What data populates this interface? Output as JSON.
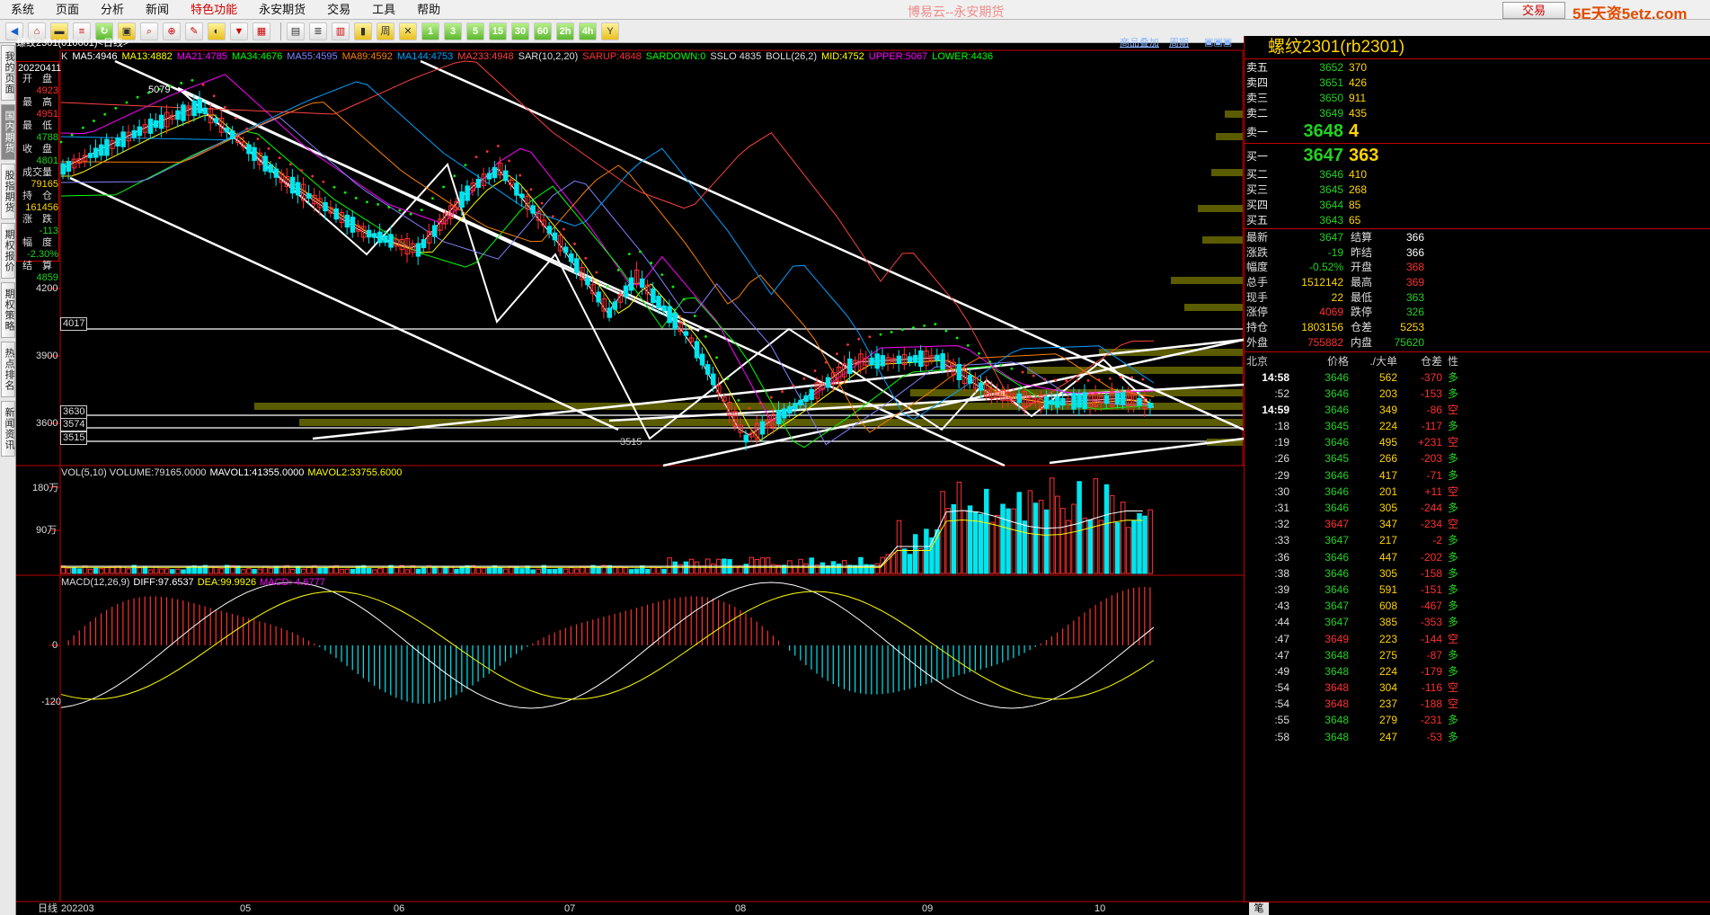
{
  "menu": [
    "系统",
    "页面",
    "分析",
    "新闻",
    "特色功能",
    "永安期货",
    "交易",
    "工具",
    "帮助"
  ],
  "app_title": "博易云--永安期货",
  "trade_button": "交易",
  "brand": "5E天资5etz.com",
  "toolbar_labels": [
    "周",
    "1",
    "3",
    "5",
    "15",
    "30",
    "60",
    "2h",
    "4h",
    "Y"
  ],
  "left_tabs": [
    "我的页面",
    "国内期货",
    "股指期货",
    "期权报价",
    "期权策略",
    "热点排名",
    "新闻资讯"
  ],
  "chart_header": {
    "symbol_line": "螺纹2301(010601)<日线>",
    "add_button": "商品叠加",
    "period_button": "周期"
  },
  "ma_line": [
    {
      "text": "K",
      "color": "#dddddd"
    },
    {
      "text": "MA5:4946",
      "color": "#ffffff"
    },
    {
      "text": "MA13:4882",
      "color": "#ffff00"
    },
    {
      "text": "MA21:4785",
      "color": "#ff00ff"
    },
    {
      "text": "MA34:4676",
      "color": "#00ff00"
    },
    {
      "text": "MA55:4595",
      "color": "#8080ff"
    },
    {
      "text": "MA89:4592",
      "color": "#ff8000"
    },
    {
      "text": "MA144:4753",
      "color": "#00a0ff"
    },
    {
      "text": "MA233:4948",
      "color": "#ff4040"
    },
    {
      "text": "SAR(10,2,20)",
      "color": "#dddddd"
    },
    {
      "text": "SARUP:4848",
      "color": "#ff3030"
    },
    {
      "text": "SARDOWN:0",
      "color": "#00ff00"
    },
    {
      "text": "SSLO 4835",
      "color": "#dddddd"
    },
    {
      "text": "BOLL(26,2)",
      "color": "#dddddd"
    },
    {
      "text": "MID:4752",
      "color": "#ffff00"
    },
    {
      "text": "UPPER:5067",
      "color": "#ff00ff"
    },
    {
      "text": "LOWER:4436",
      "color": "#00ff00"
    }
  ],
  "info_box": {
    "date": "20220411",
    "fields": [
      {
        "label": "开　盘",
        "value": "4923",
        "color": "#ff3030"
      },
      {
        "label": "最　高",
        "value": "4951",
        "color": "#ff3030"
      },
      {
        "label": "最　低",
        "value": "4788",
        "color": "#23d123"
      },
      {
        "label": "收　盘",
        "value": "4801",
        "color": "#23d123"
      },
      {
        "label": "成交量",
        "value": "79165",
        "color": "#ffd400"
      },
      {
        "label": "持　仓",
        "value": "161456",
        "color": "#ffd400"
      },
      {
        "label": "涨　跌",
        "value": "-113",
        "color": "#23d123"
      },
      {
        "label": "幅　度",
        "value": "-2.30%",
        "color": "#23d123"
      },
      {
        "label": "结　算",
        "value": "4859",
        "color": "#23d123"
      }
    ]
  },
  "price_axis": [
    "4200",
    "3900",
    "3600"
  ],
  "price_markers": [
    "4017",
    "3630",
    "3574",
    "3515"
  ],
  "annotations": {
    "high": "5079",
    "low": "3515"
  },
  "vol_header": [
    {
      "text": "VOL(5,10) VOLUME:79165.0000",
      "color": "#dddddd"
    },
    {
      "text": "MAVOL1:41355.0000",
      "color": "#ffffff"
    },
    {
      "text": "MAVOL2:33755.6000",
      "color": "#ffff00"
    }
  ],
  "vol_axis": [
    "180万",
    "90万"
  ],
  "macd_header": [
    {
      "text": "MACD(12,26,9)",
      "color": "#dddddd"
    },
    {
      "text": "DIFF:97.6537",
      "color": "#ffffff"
    },
    {
      "text": "DEA:99.9926",
      "color": "#ffff00"
    },
    {
      "text": "MACD:-4.6777",
      "color": "#ff00ff"
    }
  ],
  "macd_axis": [
    "0",
    "-120"
  ],
  "date_axis": {
    "label": "日线",
    "ticks": [
      "202203",
      "05",
      "06",
      "07",
      "08",
      "09",
      "10"
    ]
  },
  "quote": {
    "title": "螺纹2301(rb2301)",
    "asks": [
      {
        "label": "卖五",
        "price": "3652",
        "vol": "370"
      },
      {
        "label": "卖四",
        "price": "3651",
        "vol": "426"
      },
      {
        "label": "卖三",
        "price": "3650",
        "vol": "911"
      },
      {
        "label": "卖二",
        "price": "3649",
        "vol": "435"
      },
      {
        "label": "卖一",
        "price": "3648",
        "vol": "4"
      }
    ],
    "bids": [
      {
        "label": "买一",
        "price": "3647",
        "vol": "363"
      },
      {
        "label": "买二",
        "price": "3646",
        "vol": "410"
      },
      {
        "label": "买三",
        "price": "3645",
        "vol": "268"
      },
      {
        "label": "买四",
        "price": "3644",
        "vol": "85"
      },
      {
        "label": "买五",
        "price": "3643",
        "vol": "65"
      }
    ],
    "stats": [
      {
        "l1": "最新",
        "v1": "3647",
        "c1": "grn",
        "l2": "结算",
        "v2": "366",
        "c2": "wht"
      },
      {
        "l1": "涨跌",
        "v1": "-19",
        "c1": "grn",
        "l2": "昨结",
        "v2": "366",
        "c2": "wht"
      },
      {
        "l1": "幅度",
        "v1": "-0.52%",
        "c1": "grn",
        "l2": "开盘",
        "v2": "368",
        "c2": "red"
      },
      {
        "l1": "总手",
        "v1": "1512142",
        "c1": "yel",
        "l2": "最高",
        "v2": "369",
        "c2": "red"
      },
      {
        "l1": "现手",
        "v1": "22",
        "c1": "yel",
        "l2": "最低",
        "v2": "363",
        "c2": "grn"
      },
      {
        "l1": "涨停",
        "v1": "4069",
        "c1": "red",
        "l2": "跌停",
        "v2": "326",
        "c2": "grn"
      },
      {
        "l1": "持仓",
        "v1": "1803156",
        "c1": "yel",
        "l2": "仓差",
        "v2": "5253",
        "c2": "yel"
      },
      {
        "l1": "外盘",
        "v1": "755882",
        "c1": "red",
        "l2": "内盘",
        "v2": "75620",
        "c2": "grn"
      }
    ],
    "tick_header": [
      "北京",
      "价格",
      "./大单",
      "仓差",
      "性"
    ],
    "ticks": [
      {
        "t": "14:58",
        "p": "3646",
        "pc": "grn",
        "q": "562",
        "c": "-370",
        "cc": "red",
        "d": "多",
        "dc": "grn",
        "bold": true
      },
      {
        "t": ":52",
        "p": "3646",
        "pc": "grn",
        "q": "203",
        "c": "-153",
        "cc": "red",
        "d": "多",
        "dc": "grn"
      },
      {
        "t": "14:59",
        "p": "3646",
        "pc": "grn",
        "q": "349",
        "c": "-86",
        "cc": "red",
        "d": "空",
        "dc": "red",
        "bold": true
      },
      {
        "t": ":18",
        "p": "3645",
        "pc": "grn",
        "q": "224",
        "c": "-117",
        "cc": "red",
        "d": "多",
        "dc": "grn"
      },
      {
        "t": ":19",
        "p": "3646",
        "pc": "grn",
        "q": "495",
        "c": "+231",
        "cc": "red",
        "d": "空",
        "dc": "red"
      },
      {
        "t": ":26",
        "p": "3645",
        "pc": "grn",
        "q": "266",
        "c": "-203",
        "cc": "red",
        "d": "多",
        "dc": "grn"
      },
      {
        "t": ":29",
        "p": "3646",
        "pc": "grn",
        "q": "417",
        "c": "-71",
        "cc": "red",
        "d": "多",
        "dc": "grn"
      },
      {
        "t": ":30",
        "p": "3646",
        "pc": "grn",
        "q": "201",
        "c": "+11",
        "cc": "red",
        "d": "空",
        "dc": "red"
      },
      {
        "t": ":31",
        "p": "3646",
        "pc": "grn",
        "q": "305",
        "c": "-244",
        "cc": "red",
        "d": "多",
        "dc": "grn"
      },
      {
        "t": ":32",
        "p": "3647",
        "pc": "red",
        "q": "347",
        "c": "-234",
        "cc": "red",
        "d": "空",
        "dc": "red"
      },
      {
        "t": ":33",
        "p": "3647",
        "pc": "grn",
        "q": "217",
        "c": "-2",
        "cc": "red",
        "d": "多",
        "dc": "grn"
      },
      {
        "t": ":36",
        "p": "3646",
        "pc": "grn",
        "q": "447",
        "c": "-202",
        "cc": "red",
        "d": "多",
        "dc": "grn"
      },
      {
        "t": ":38",
        "p": "3646",
        "pc": "grn",
        "q": "305",
        "c": "-158",
        "cc": "red",
        "d": "多",
        "dc": "grn"
      },
      {
        "t": ":39",
        "p": "3646",
        "pc": "grn",
        "q": "591",
        "c": "-151",
        "cc": "red",
        "d": "多",
        "dc": "grn"
      },
      {
        "t": ":43",
        "p": "3647",
        "pc": "grn",
        "q": "608",
        "c": "-467",
        "cc": "red",
        "d": "多",
        "dc": "grn"
      },
      {
        "t": ":44",
        "p": "3647",
        "pc": "grn",
        "q": "385",
        "c": "-353",
        "cc": "red",
        "d": "多",
        "dc": "grn"
      },
      {
        "t": ":47",
        "p": "3649",
        "pc": "red",
        "q": "223",
        "c": "-144",
        "cc": "red",
        "d": "空",
        "dc": "red"
      },
      {
        "t": ":47",
        "p": "3648",
        "pc": "grn",
        "q": "275",
        "c": "-87",
        "cc": "red",
        "d": "多",
        "dc": "grn"
      },
      {
        "t": ":49",
        "p": "3648",
        "pc": "grn",
        "q": "224",
        "c": "-179",
        "cc": "red",
        "d": "多",
        "dc": "grn"
      },
      {
        "t": ":54",
        "p": "3648",
        "pc": "red",
        "q": "304",
        "c": "-116",
        "cc": "red",
        "d": "空",
        "dc": "red"
      },
      {
        "t": ":54",
        "p": "3648",
        "pc": "red",
        "q": "237",
        "c": "-188",
        "cc": "red",
        "d": "空",
        "dc": "red"
      },
      {
        "t": ":55",
        "p": "3648",
        "pc": "grn",
        "q": "279",
        "c": "-231",
        "cc": "red",
        "d": "多",
        "dc": "grn"
      },
      {
        "t": ":58",
        "p": "3648",
        "pc": "grn",
        "q": "247",
        "c": "-53",
        "cc": "red",
        "d": "多",
        "dc": "grn"
      }
    ],
    "footer_tab": "笔"
  },
  "colors": {
    "up": "#ff3030",
    "down": "#00e5ee",
    "grid": "#c00000",
    "accent": "#ffd400"
  }
}
